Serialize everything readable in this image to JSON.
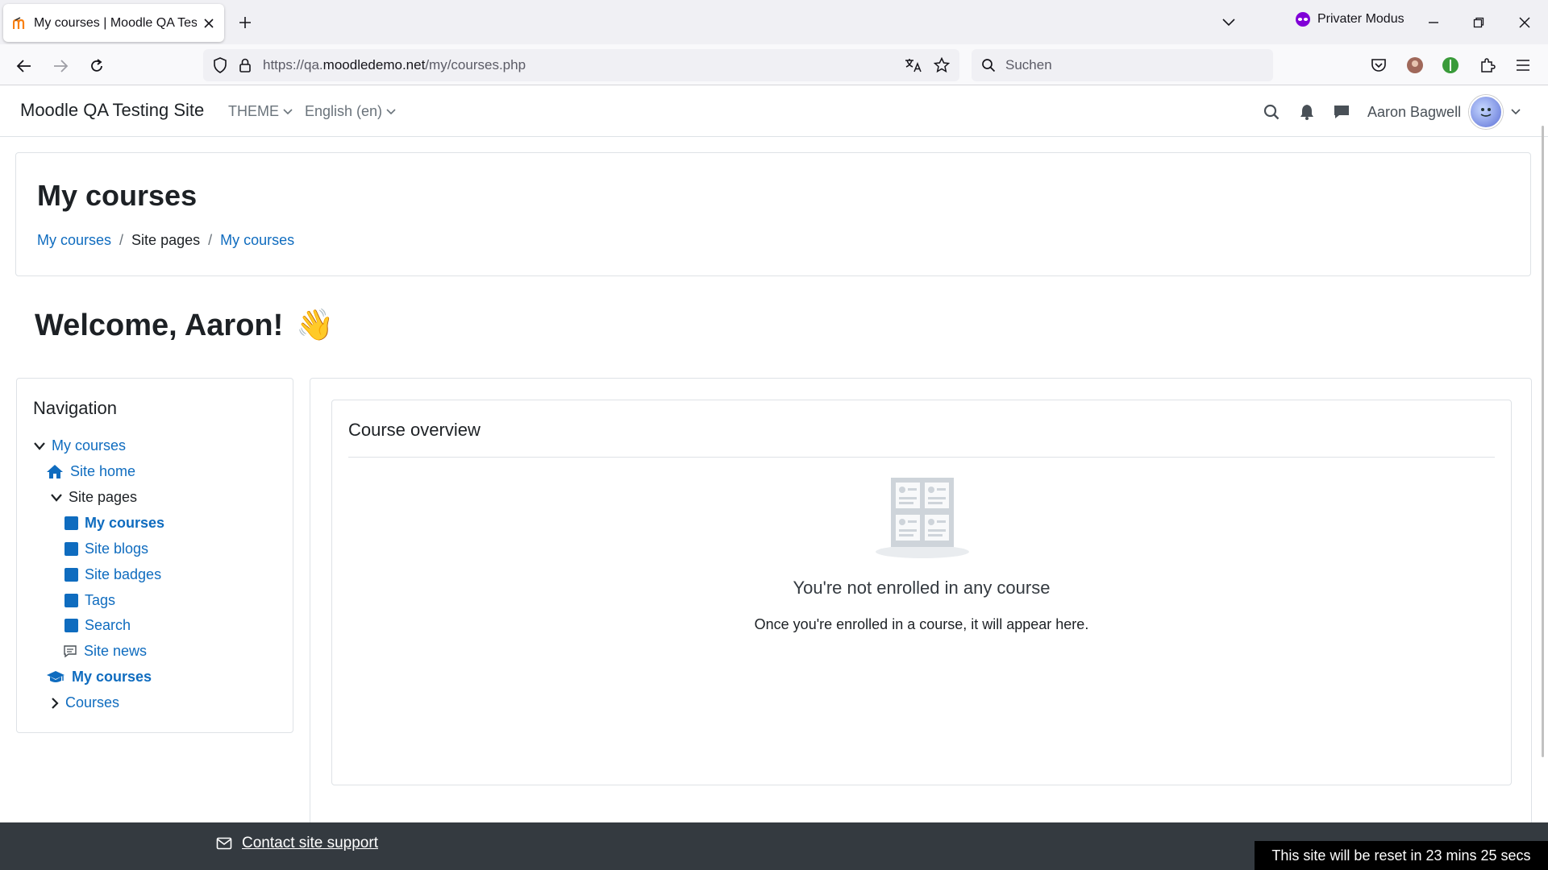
{
  "browser": {
    "tab_title": "My courses | Moodle QA Testing Site",
    "private_label": "Privater Modus",
    "url_prefix": "https://qa.",
    "url_domain": "moodledemo.net",
    "url_path": "/my/courses.php",
    "search_placeholder": "Suchen"
  },
  "navbar": {
    "brand": "Moodle QA Testing Site",
    "theme_label": "THEME",
    "language_label": "English (en)",
    "user_name": "Aaron Bagwell"
  },
  "header": {
    "title": "My courses",
    "breadcrumbs": [
      "My courses",
      "Site pages",
      "My courses"
    ],
    "separator": "/"
  },
  "welcome": {
    "text": "Welcome, Aaron!",
    "emoji": "👋"
  },
  "navigation": {
    "title": "Navigation",
    "items": [
      {
        "label": "My courses"
      },
      {
        "label": "Site home"
      },
      {
        "label": "Site pages"
      },
      {
        "label": "My courses"
      },
      {
        "label": "Site blogs"
      },
      {
        "label": "Site badges"
      },
      {
        "label": "Tags"
      },
      {
        "label": "Search"
      },
      {
        "label": "Site news"
      },
      {
        "label": "My courses"
      },
      {
        "label": "Courses"
      }
    ]
  },
  "course_overview": {
    "title": "Course overview",
    "empty_title": "You're not enrolled in any course",
    "empty_message": "Once you're enrolled in a course, it will appear here."
  },
  "footer": {
    "support_label": "Contact site support",
    "reset_notice": "This site will be reset in 23 mins 25 secs"
  },
  "colors": {
    "link": "#0f6cbf",
    "footer_bg": "#343a40",
    "private_accent": "#8000d7"
  }
}
